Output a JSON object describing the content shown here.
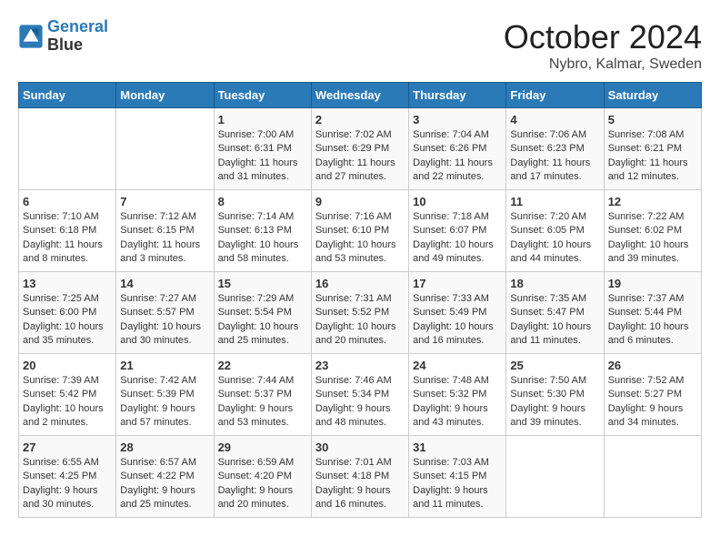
{
  "header": {
    "logo_line1": "General",
    "logo_line2": "Blue",
    "month": "October 2024",
    "location": "Nybro, Kalmar, Sweden"
  },
  "days_of_week": [
    "Sunday",
    "Monday",
    "Tuesday",
    "Wednesday",
    "Thursday",
    "Friday",
    "Saturday"
  ],
  "weeks": [
    [
      {
        "day": "",
        "info": ""
      },
      {
        "day": "",
        "info": ""
      },
      {
        "day": "1",
        "sunrise": "Sunrise: 7:00 AM",
        "sunset": "Sunset: 6:31 PM",
        "daylight": "Daylight: 11 hours and 31 minutes."
      },
      {
        "day": "2",
        "sunrise": "Sunrise: 7:02 AM",
        "sunset": "Sunset: 6:29 PM",
        "daylight": "Daylight: 11 hours and 27 minutes."
      },
      {
        "day": "3",
        "sunrise": "Sunrise: 7:04 AM",
        "sunset": "Sunset: 6:26 PM",
        "daylight": "Daylight: 11 hours and 22 minutes."
      },
      {
        "day": "4",
        "sunrise": "Sunrise: 7:06 AM",
        "sunset": "Sunset: 6:23 PM",
        "daylight": "Daylight: 11 hours and 17 minutes."
      },
      {
        "day": "5",
        "sunrise": "Sunrise: 7:08 AM",
        "sunset": "Sunset: 6:21 PM",
        "daylight": "Daylight: 11 hours and 12 minutes."
      }
    ],
    [
      {
        "day": "6",
        "sunrise": "Sunrise: 7:10 AM",
        "sunset": "Sunset: 6:18 PM",
        "daylight": "Daylight: 11 hours and 8 minutes."
      },
      {
        "day": "7",
        "sunrise": "Sunrise: 7:12 AM",
        "sunset": "Sunset: 6:15 PM",
        "daylight": "Daylight: 11 hours and 3 minutes."
      },
      {
        "day": "8",
        "sunrise": "Sunrise: 7:14 AM",
        "sunset": "Sunset: 6:13 PM",
        "daylight": "Daylight: 10 hours and 58 minutes."
      },
      {
        "day": "9",
        "sunrise": "Sunrise: 7:16 AM",
        "sunset": "Sunset: 6:10 PM",
        "daylight": "Daylight: 10 hours and 53 minutes."
      },
      {
        "day": "10",
        "sunrise": "Sunrise: 7:18 AM",
        "sunset": "Sunset: 6:07 PM",
        "daylight": "Daylight: 10 hours and 49 minutes."
      },
      {
        "day": "11",
        "sunrise": "Sunrise: 7:20 AM",
        "sunset": "Sunset: 6:05 PM",
        "daylight": "Daylight: 10 hours and 44 minutes."
      },
      {
        "day": "12",
        "sunrise": "Sunrise: 7:22 AM",
        "sunset": "Sunset: 6:02 PM",
        "daylight": "Daylight: 10 hours and 39 minutes."
      }
    ],
    [
      {
        "day": "13",
        "sunrise": "Sunrise: 7:25 AM",
        "sunset": "Sunset: 6:00 PM",
        "daylight": "Daylight: 10 hours and 35 minutes."
      },
      {
        "day": "14",
        "sunrise": "Sunrise: 7:27 AM",
        "sunset": "Sunset: 5:57 PM",
        "daylight": "Daylight: 10 hours and 30 minutes."
      },
      {
        "day": "15",
        "sunrise": "Sunrise: 7:29 AM",
        "sunset": "Sunset: 5:54 PM",
        "daylight": "Daylight: 10 hours and 25 minutes."
      },
      {
        "day": "16",
        "sunrise": "Sunrise: 7:31 AM",
        "sunset": "Sunset: 5:52 PM",
        "daylight": "Daylight: 10 hours and 20 minutes."
      },
      {
        "day": "17",
        "sunrise": "Sunrise: 7:33 AM",
        "sunset": "Sunset: 5:49 PM",
        "daylight": "Daylight: 10 hours and 16 minutes."
      },
      {
        "day": "18",
        "sunrise": "Sunrise: 7:35 AM",
        "sunset": "Sunset: 5:47 PM",
        "daylight": "Daylight: 10 hours and 11 minutes."
      },
      {
        "day": "19",
        "sunrise": "Sunrise: 7:37 AM",
        "sunset": "Sunset: 5:44 PM",
        "daylight": "Daylight: 10 hours and 6 minutes."
      }
    ],
    [
      {
        "day": "20",
        "sunrise": "Sunrise: 7:39 AM",
        "sunset": "Sunset: 5:42 PM",
        "daylight": "Daylight: 10 hours and 2 minutes."
      },
      {
        "day": "21",
        "sunrise": "Sunrise: 7:42 AM",
        "sunset": "Sunset: 5:39 PM",
        "daylight": "Daylight: 9 hours and 57 minutes."
      },
      {
        "day": "22",
        "sunrise": "Sunrise: 7:44 AM",
        "sunset": "Sunset: 5:37 PM",
        "daylight": "Daylight: 9 hours and 53 minutes."
      },
      {
        "day": "23",
        "sunrise": "Sunrise: 7:46 AM",
        "sunset": "Sunset: 5:34 PM",
        "daylight": "Daylight: 9 hours and 48 minutes."
      },
      {
        "day": "24",
        "sunrise": "Sunrise: 7:48 AM",
        "sunset": "Sunset: 5:32 PM",
        "daylight": "Daylight: 9 hours and 43 minutes."
      },
      {
        "day": "25",
        "sunrise": "Sunrise: 7:50 AM",
        "sunset": "Sunset: 5:30 PM",
        "daylight": "Daylight: 9 hours and 39 minutes."
      },
      {
        "day": "26",
        "sunrise": "Sunrise: 7:52 AM",
        "sunset": "Sunset: 5:27 PM",
        "daylight": "Daylight: 9 hours and 34 minutes."
      }
    ],
    [
      {
        "day": "27",
        "sunrise": "Sunrise: 6:55 AM",
        "sunset": "Sunset: 4:25 PM",
        "daylight": "Daylight: 9 hours and 30 minutes."
      },
      {
        "day": "28",
        "sunrise": "Sunrise: 6:57 AM",
        "sunset": "Sunset: 4:22 PM",
        "daylight": "Daylight: 9 hours and 25 minutes."
      },
      {
        "day": "29",
        "sunrise": "Sunrise: 6:59 AM",
        "sunset": "Sunset: 4:20 PM",
        "daylight": "Daylight: 9 hours and 20 minutes."
      },
      {
        "day": "30",
        "sunrise": "Sunrise: 7:01 AM",
        "sunset": "Sunset: 4:18 PM",
        "daylight": "Daylight: 9 hours and 16 minutes."
      },
      {
        "day": "31",
        "sunrise": "Sunrise: 7:03 AM",
        "sunset": "Sunset: 4:15 PM",
        "daylight": "Daylight: 9 hours and 11 minutes."
      },
      {
        "day": "",
        "info": ""
      },
      {
        "day": "",
        "info": ""
      }
    ]
  ]
}
